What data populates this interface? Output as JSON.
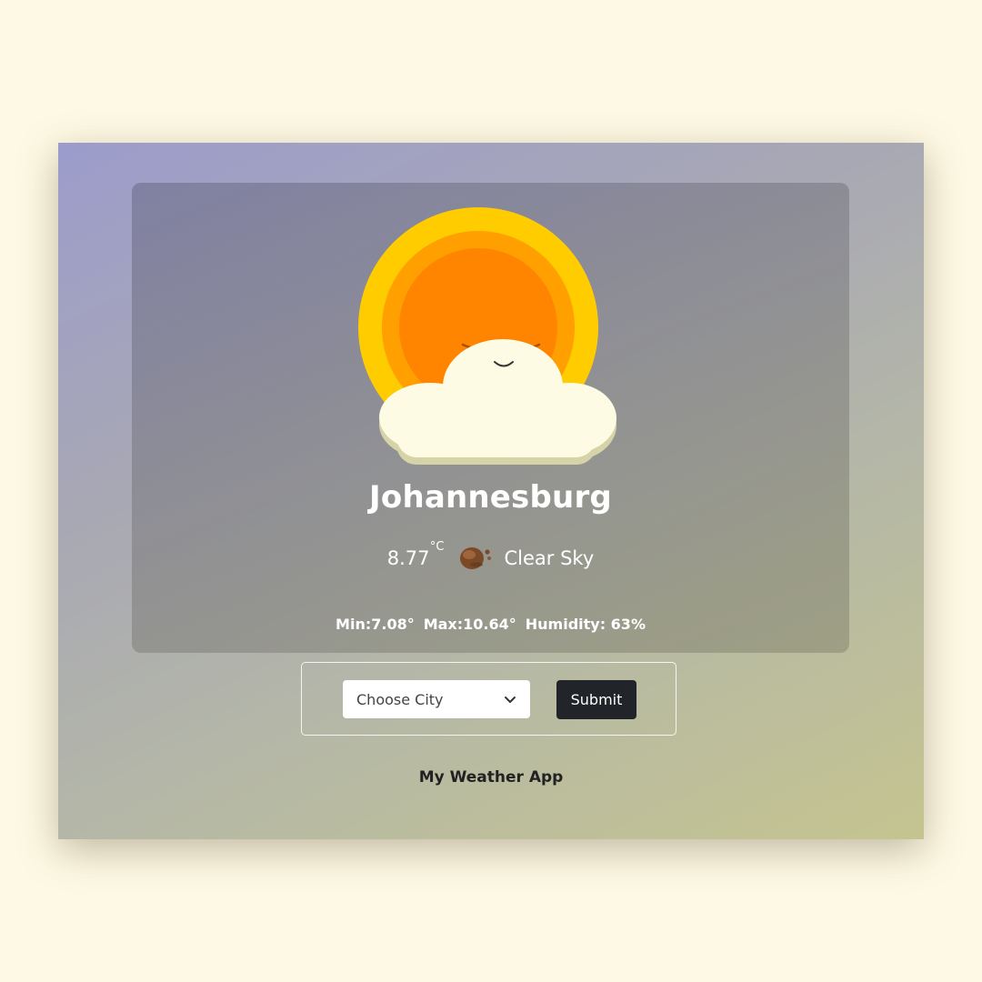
{
  "weather": {
    "city": "Johannesburg",
    "temperature": "8.77",
    "temperature_unit": "°C",
    "condition": "Clear Sky",
    "condition_icon": "cloudy-moon-icon",
    "illustration": "sun-behind-cloud-icon",
    "min": "Min:7.08°",
    "max": "Max:10.64°",
    "humidity": "Humidity: 63%"
  },
  "form": {
    "select_value": "Choose City",
    "submit_label": "Submit"
  },
  "footer": {
    "title": "My Weather App"
  },
  "colors": {
    "page_background": "#fef9e4",
    "button_background": "#212529",
    "sun_outer": "#ffcc00",
    "sun_inner": "#ff8500",
    "cloud": "#fdfbe4"
  }
}
